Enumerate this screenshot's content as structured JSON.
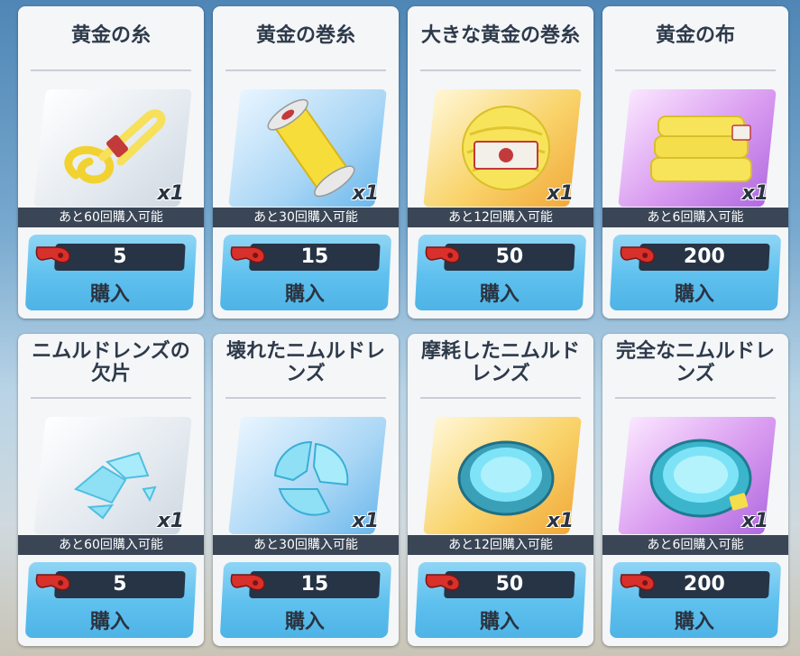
{
  "qty_label": "x1",
  "buy_label": "購入",
  "icons": {
    "currency": "red-whistle-icon"
  },
  "colors": {
    "button": "#5ec0ee",
    "price_bar": "#263445",
    "remain_bar": "#3a4656"
  },
  "items": [
    {
      "name": "黄金の糸",
      "remaining": "あと60回購入可能",
      "price": "5",
      "icon": "gold-thread-icon"
    },
    {
      "name": "黄金の巻糸",
      "remaining": "あと30回購入可能",
      "price": "15",
      "icon": "gold-spool-icon"
    },
    {
      "name": "大きな黄金の巻糸",
      "remaining": "あと12回購入可能",
      "price": "50",
      "icon": "gold-yarn-ball-icon"
    },
    {
      "name": "黄金の布",
      "remaining": "あと6回購入可能",
      "price": "200",
      "icon": "gold-cloth-icon"
    },
    {
      "name": "ニムルドレンズの欠片",
      "remaining": "あと60回購入可能",
      "price": "5",
      "icon": "lens-shards-icon"
    },
    {
      "name": "壊れたニムルドレンズ",
      "remaining": "あと30回購入可能",
      "price": "15",
      "icon": "broken-lens-icon"
    },
    {
      "name": "摩耗したニムルドレンズ",
      "remaining": "あと12回購入可能",
      "price": "50",
      "icon": "worn-lens-icon"
    },
    {
      "name": "完全なニムルドレンズ",
      "remaining": "あと6回購入可能",
      "price": "200",
      "icon": "complete-lens-icon"
    }
  ]
}
